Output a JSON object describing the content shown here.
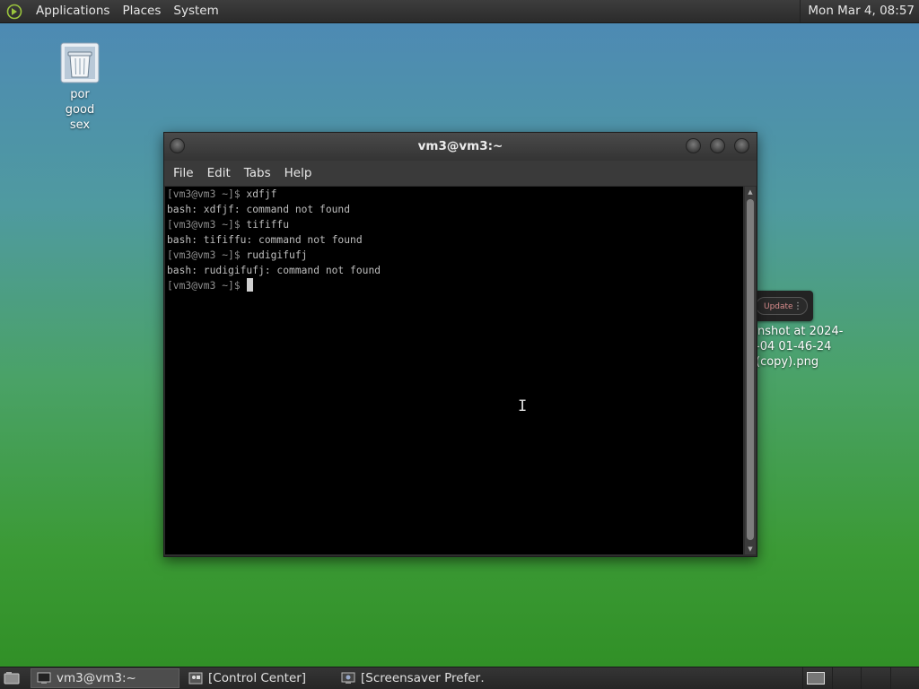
{
  "top_panel": {
    "menus": [
      "Applications",
      "Places",
      "System"
    ],
    "clock": "Mon Mar  4, 08:57"
  },
  "desktop": {
    "trash_label_lines": [
      "por",
      "good",
      "sex"
    ],
    "screenshot_label_lines": [
      "enshot at 2024-",
      "-04 01-46-24",
      "(copy).png"
    ],
    "update_button": "Update"
  },
  "terminal": {
    "title": "vm3@vm3:~",
    "menu": [
      "File",
      "Edit",
      "Tabs",
      "Help"
    ],
    "lines": [
      {
        "prompt": "[vm3@vm3 ~]$ ",
        "text": "xdfjf"
      },
      {
        "prompt": "",
        "text": "bash: xdfjf: command not found"
      },
      {
        "prompt": "[vm3@vm3 ~]$ ",
        "text": "tififfu"
      },
      {
        "prompt": "",
        "text": "bash: tififfu: command not found"
      },
      {
        "prompt": "[vm3@vm3 ~]$ ",
        "text": "rudigifufj"
      },
      {
        "prompt": "",
        "text": "bash: rudigifufj: command not found"
      }
    ],
    "current_prompt": "[vm3@vm3 ~]$ "
  },
  "taskbar": {
    "tasks": [
      {
        "label": "vm3@vm3:~",
        "icon": "terminal-icon",
        "active": true
      },
      {
        "label": "[Control Center]",
        "icon": "control-center-icon",
        "active": false
      },
      {
        "label": "[Screensaver Prefer…",
        "icon": "screensaver-icon",
        "active": false
      }
    ]
  },
  "colors": {
    "panel": "#2b2b2b",
    "terminal_bg": "#000000",
    "terminal_fg": "#bfbfbf"
  }
}
